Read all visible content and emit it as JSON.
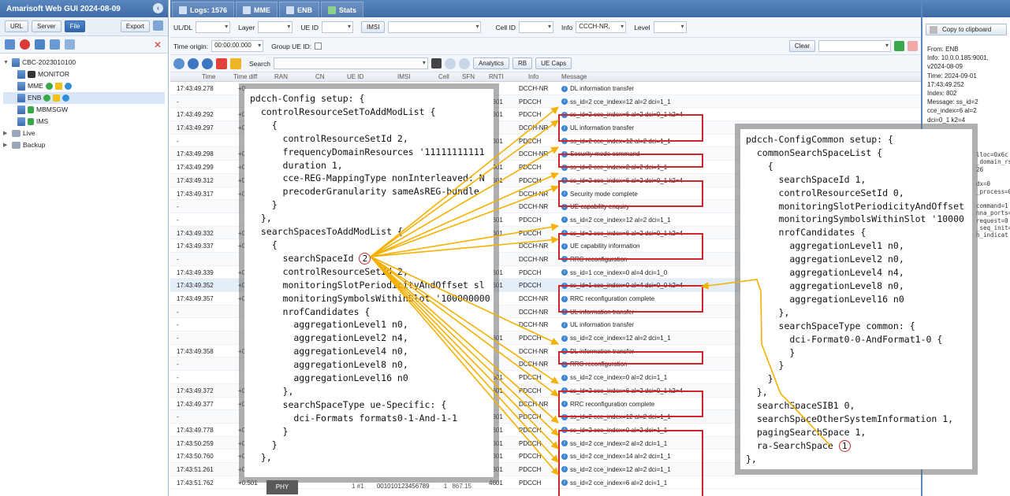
{
  "app": {
    "title": "Amarisoft Web GUI 2024-08-09"
  },
  "left_tools": {
    "url": "URL",
    "server": "Server",
    "file": "File",
    "export": "Export"
  },
  "tree": [
    {
      "label": "CBC-2023010100",
      "level": 0,
      "expanded": true
    },
    {
      "label": "MONITOR",
      "level": 1
    },
    {
      "label": "MME",
      "level": 1
    },
    {
      "label": "ENB",
      "level": 1,
      "selected": true
    },
    {
      "label": "MBMSGW",
      "level": 1
    },
    {
      "label": "IMS",
      "level": 1
    },
    {
      "label": "Live",
      "level": 0
    },
    {
      "label": "Backup",
      "level": 0
    }
  ],
  "tabs": [
    "Logs: 1576",
    "MME",
    "ENB",
    "Stats"
  ],
  "filters": {
    "uldl": "UL/DL",
    "layer": "Layer",
    "ueid": "UE ID",
    "imsi": "IMSI",
    "cellid": "Cell ID",
    "info": "Info",
    "info_value": "CCCH-NR,",
    "level": "Level",
    "time_origin": "Time origin:",
    "time_origin_value": "00:00:00.000",
    "group_ueid": "Group UE ID:",
    "clear": "Clear",
    "search": "Search",
    "analytics": "Analytics",
    "rb": "RB",
    "uecaps": "UE Caps"
  },
  "columns": [
    "Time",
    "Time diff",
    "RAN",
    "CN",
    "UE ID",
    "IMSI",
    "Cell",
    "SFN",
    "RNTI",
    "Info",
    "Message"
  ],
  "rows": [
    {
      "time": "17:43:49.278",
      "diff": "+0",
      "rnti": "",
      "info": "DCCH-NR",
      "msg": "DL information transfer"
    },
    {
      "time": "-",
      "diff": "",
      "rnti": "4601",
      "info": "PDCCH",
      "msg": "ss_id=2 cce_index=12 al=2 dci=1_1"
    },
    {
      "time": "17:43:49.292",
      "diff": "+0",
      "rnti": "4601",
      "info": "PDCCH",
      "msg": "ss_id=2 cce_index=6 al=2 dci=0_1 k2=4"
    },
    {
      "time": "17:43:49.297",
      "diff": "+0",
      "rnti": "",
      "info": "DCCH-NR",
      "msg": "UL information transfer"
    },
    {
      "time": "-",
      "diff": "",
      "rnti": "4601",
      "info": "PDCCH",
      "msg": "ss_id=2 cce_index=12 al=2 dci=1_1"
    },
    {
      "time": "17:43:49.298",
      "diff": "+0",
      "rnti": "",
      "info": "DCCH-NR",
      "msg": "Security mode command"
    },
    {
      "time": "17:43:49.299",
      "diff": "+0",
      "rnti": "4601",
      "info": "PDCCH",
      "msg": "ss_id=2 cce_index=2 al=2 dci=1_1"
    },
    {
      "time": "17:43:49.312",
      "diff": "+0",
      "rnti": "4601",
      "info": "PDCCH",
      "msg": "ss_id=2 cce_index=6 al=2 dci=0_1 k2=4"
    },
    {
      "time": "17:43:49.317",
      "diff": "+0",
      "rnti": "",
      "info": "DCCH-NR",
      "msg": "Security mode complete"
    },
    {
      "time": "-",
      "diff": "",
      "rnti": "",
      "info": "DCCH-NR",
      "msg": "UE capability enquiry"
    },
    {
      "time": "-",
      "diff": "",
      "rnti": "4601",
      "info": "PDCCH",
      "msg": "ss_id=2 cce_index=12 al=2 dci=1_1"
    },
    {
      "time": "17:43:49.332",
      "diff": "+0",
      "rnti": "4601",
      "info": "PDCCH",
      "msg": "ss_id=2 cce_index=6 al=2 dci=0_1 k2=4"
    },
    {
      "time": "17:43:49.337",
      "diff": "+0",
      "rnti": "",
      "info": "DCCH-NR",
      "msg": "UE capability information"
    },
    {
      "time": "-",
      "diff": "",
      "rnti": "",
      "info": "DCCH-NR",
      "msg": "RRC reconfiguration"
    },
    {
      "time": "17:43:49.339",
      "diff": "+0",
      "rnti": "4601",
      "info": "PDCCH",
      "msg": "ss_id=1 cce_index=0 al=4 dci=1_0"
    },
    {
      "time": "17:43:49.352",
      "diff": "+0",
      "rnti": "4601",
      "info": "PDCCH",
      "msg": "ss_id=1 cce_index=0 al=4 dci=0_0 k2=4"
    },
    {
      "time": "17:43:49.357",
      "diff": "+0",
      "rnti": "",
      "info": "DCCH-NR",
      "msg": "RRC reconfiguration complete"
    },
    {
      "time": "-",
      "diff": "",
      "rnti": "",
      "info": "DCCH-NR",
      "msg": "UL information transfer"
    },
    {
      "time": "-",
      "diff": "",
      "rnti": "",
      "info": "DCCH-NR",
      "msg": "UL information transfer"
    },
    {
      "time": "-",
      "diff": "",
      "rnti": "4601",
      "info": "PDCCH",
      "msg": "ss_id=2 cce_index=12 al=2 dci=1_1"
    },
    {
      "time": "17:43:49.358",
      "diff": "+0",
      "rnti": "",
      "info": "DCCH-NR",
      "msg": "DL information transfer"
    },
    {
      "time": "-",
      "diff": "",
      "rnti": "",
      "info": "DCCH-NR",
      "msg": "RRC reconfiguration"
    },
    {
      "time": "-",
      "diff": "",
      "rnti": "4601",
      "info": "PDCCH",
      "msg": "ss_id=2 cce_index=0 al=2 dci=1_1"
    },
    {
      "time": "17:43:49.372",
      "diff": "+0",
      "rnti": "4601",
      "info": "PDCCH",
      "msg": "ss_id=2 cce_index=6 al=2 dci=0_1 k2=4"
    },
    {
      "time": "17:43:49.377",
      "diff": "+0",
      "rnti": "",
      "info": "DCCH-NR",
      "msg": "RRC reconfiguration complete"
    },
    {
      "time": "-",
      "diff": "",
      "rnti": "4601",
      "info": "PDCCH",
      "msg": "ss_id=2 cce_index=12 al=2 dci=1_1"
    },
    {
      "time": "17:43:49.778",
      "diff": "+0",
      "rnti": "4601",
      "info": "PDCCH",
      "msg": "ss_id=2 cce_index=0 al=2 dci=1_1"
    },
    {
      "time": "17:43:50.259",
      "diff": "+0",
      "rnti": "4601",
      "info": "PDCCH",
      "msg": "ss_id=2 cce_index=2 al=2 dci=1_1"
    },
    {
      "time": "17:43:50.760",
      "diff": "+0",
      "rnti": "4601",
      "info": "PDCCH",
      "msg": "ss_id=2 cce_index=14 al=2 dci=1_1"
    },
    {
      "time": "17:43:51.261",
      "diff": "+0",
      "rnti": "4601",
      "info": "PDCCH",
      "msg": "ss_id=2 cce_index=12 al=2 dci=1_1"
    },
    {
      "time": "17:43:51.762",
      "diff": "+0.501",
      "rnti": "4601",
      "info": "PDCCH",
      "msg": "ss_id=2 cce_index=6 al=2 dci=1_1"
    }
  ],
  "last_row_extra": {
    "ue": "1 #1",
    "imsi": "001010123456789",
    "cell": "1",
    "sfn": "867.15"
  },
  "popup_left": [
    "pdcch-Config setup: {",
    "  controlResourceSetToAddModList {",
    "    {",
    "      controlResourceSetId 2,",
    "      frequencyDomainResources '11111111111",
    "      duration 1,",
    "      cce-REG-MappingType nonInterleaved: N",
    "      precoderGranularity sameAsREG-bundle",
    "    }",
    "  },",
    "  searchSpacesToAddModList {",
    "    {",
    "      searchSpaceId ",
    "      controlResourceSetId 2,",
    "      monitoringSlotPeriodicityAndOffset sl",
    "      monitoringSymbolsWithinSlot '100000000",
    "      nrofCandidates {",
    "        aggregationLevel1 n0,",
    "        aggregationLevel2 n4,",
    "        aggregationLevel4 n0,",
    "        aggregationLevel8 n0,",
    "        aggregationLevel16 n0",
    "      },",
    "      searchSpaceType ue-Specific: {",
    "        dci-Formats formats0-1-And-1-1",
    "      }",
    "    }",
    "  },"
  ],
  "popup_left_mark": "2",
  "popup_right": [
    "pdcch-ConfigCommon setup: {",
    "  commonSearchSpaceList {",
    "    {",
    "      searchSpaceId 1,",
    "      controlResourceSetId 0,",
    "      monitoringSlotPeriodicityAndOffset",
    "      monitoringSymbolsWithinSlot '10000",
    "      nrofCandidates {",
    "        aggregationLevel1 n0,",
    "        aggregationLevel2 n0,",
    "        aggregationLevel4 n4,",
    "        aggregationLevel8 n0,",
    "        aggregationLevel16 n0",
    "      },",
    "      searchSpaceType common: {",
    "        dci-Format0-0-AndFormat1-0 {",
    "        }",
    "      }",
    "    }",
    "  },",
    "  searchSpaceSIB1 0,",
    "  searchSpaceOtherSystemInformation 1,",
    "  pagingSearchSpace 1,",
    "  ra-SearchSpace ",
    "},"
  ],
  "popup_right_mark": "1",
  "right_panel": {
    "copy": "Copy to clipboard",
    "details": [
      "From: ENB",
      "Info: 10.0.0.185:9001,",
      "v2024-08-09",
      "Time: 2024-09-01",
      "17:43:49.252",
      "Index: 802",
      "Message: ss_id=2",
      "cce_index=6 al=2",
      "dci=0_1 k2=4"
    ],
    "fragments": [
      "lloc=0x6c",
      "_domain_rs",
      "26",
      "",
      "dx=0",
      "_process=0",
      "",
      "command=1",
      "nna_ports=",
      "request=0",
      "_seq_init=",
      "h_indicat"
    ]
  },
  "phy_label": "PHY",
  "colors": {
    "accent": "#3e6aa6",
    "highlight": "#d0262b",
    "arrow": "#f5b000"
  }
}
